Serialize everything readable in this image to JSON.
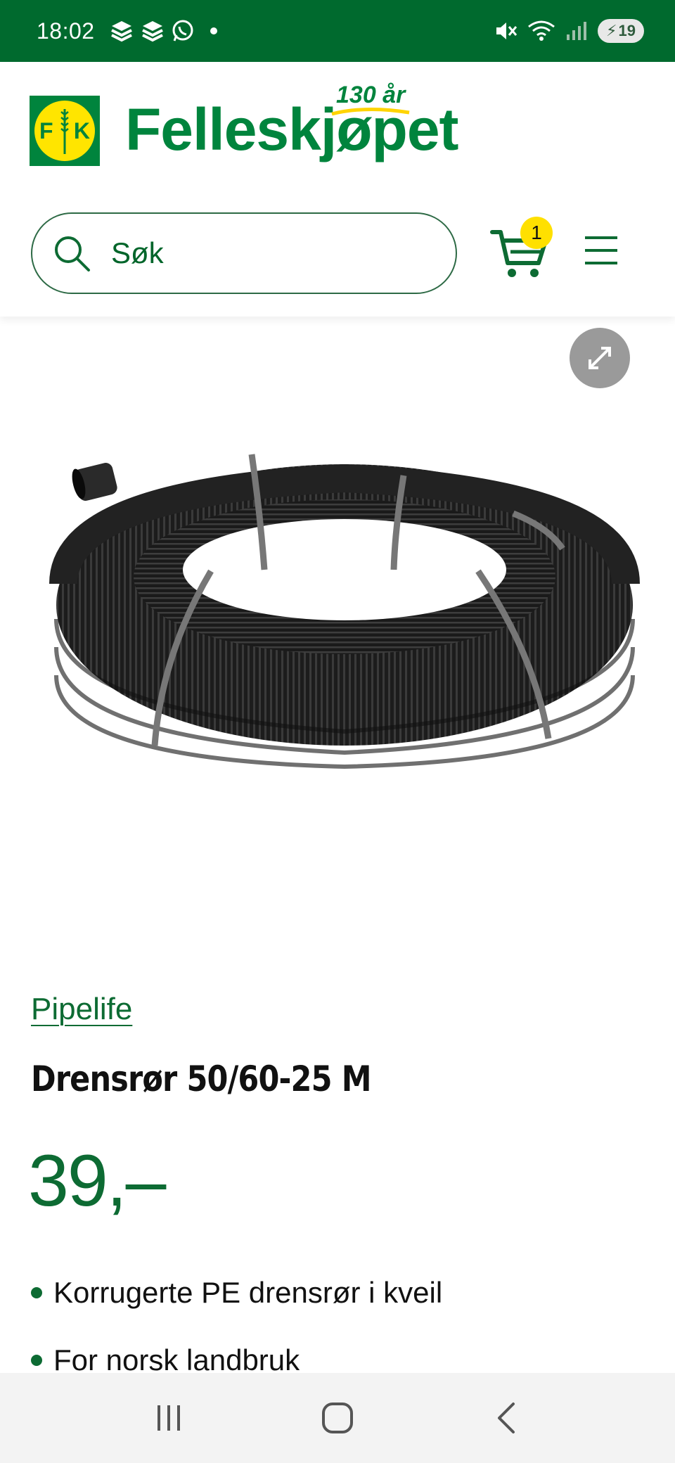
{
  "status_bar": {
    "time": "18:02",
    "battery_level": "19",
    "background_color": "#006a2e"
  },
  "header": {
    "logo_letters_left": "F",
    "logo_letters_right": "K",
    "brand_name": "Felleskjøpet",
    "anniversary": "130 år",
    "search_placeholder": "Søk",
    "cart_count": "1",
    "accent_color": "#00843d",
    "badge_color": "#ffe000"
  },
  "product": {
    "brand": "Pipelife",
    "title": "Drensrør 50/60-25 M",
    "price": "39,–",
    "features": [
      "Korrugerte PE drensrør i kveil",
      "For norsk landbruk"
    ]
  },
  "icons": {
    "search": "search-icon",
    "cart": "cart-icon",
    "menu": "hamburger-menu-icon",
    "expand": "expand-icon",
    "nav_recent": "recent-apps-icon",
    "nav_home": "home-icon",
    "nav_back": "back-icon"
  }
}
